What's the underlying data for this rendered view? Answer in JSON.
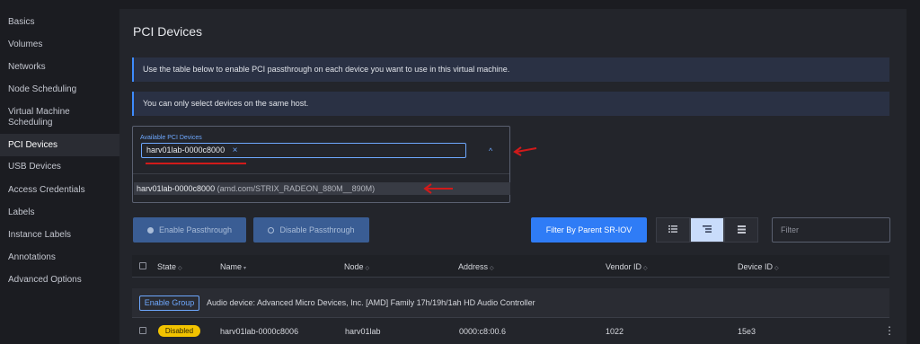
{
  "sidebar": {
    "items": [
      {
        "label": "Basics"
      },
      {
        "label": "Volumes"
      },
      {
        "label": "Networks"
      },
      {
        "label": "Node Scheduling"
      },
      {
        "label": "Virtual Machine Scheduling"
      },
      {
        "label": "PCI Devices",
        "active": true
      },
      {
        "label": "USB Devices"
      },
      {
        "label": "Access Credentials"
      },
      {
        "label": "Labels"
      },
      {
        "label": "Instance Labels"
      },
      {
        "label": "Annotations"
      },
      {
        "label": "Advanced Options"
      }
    ]
  },
  "main": {
    "title": "PCI Devices",
    "banners": [
      "Use the table below to enable PCI passthrough on each device you want to use in this virtual machine.",
      "You can only select devices on the same host."
    ],
    "picker": {
      "label": "Available PCI Devices",
      "selected": "harv01lab-0000c8000",
      "remove_glyph": "×",
      "caret_glyph": "^",
      "option_name": "harv01lab-0000c8000",
      "option_detail": "(amd.com/STRIX_RADEON_880M__890M)"
    },
    "toolbar": {
      "enable_label": "Enable Passthrough",
      "disable_label": "Disable Passthrough",
      "filter_parent_label": "Filter By Parent SR-IOV",
      "filter_placeholder": "Filter"
    },
    "table": {
      "columns": {
        "state": "State",
        "name": "Name",
        "node": "Node",
        "address": "Address",
        "vendor_id": "Vendor ID",
        "device_id": "Device ID"
      },
      "group": {
        "button_label": "Enable Group",
        "text": "Audio device: Advanced Micro Devices, Inc. [AMD] Family 17h/19h/1ah HD Audio Controller"
      },
      "rows": [
        {
          "state": "Disabled",
          "name": "harv01lab-0000c8006",
          "node": "harv01lab",
          "address": "0000:c8:00.6",
          "vendor_id": "1022",
          "device_id": "15e3"
        }
      ]
    }
  },
  "colors": {
    "accent": "#2f7cf6",
    "annotation_red": "#d11a1a",
    "badge_yellow": "#f2c300"
  }
}
